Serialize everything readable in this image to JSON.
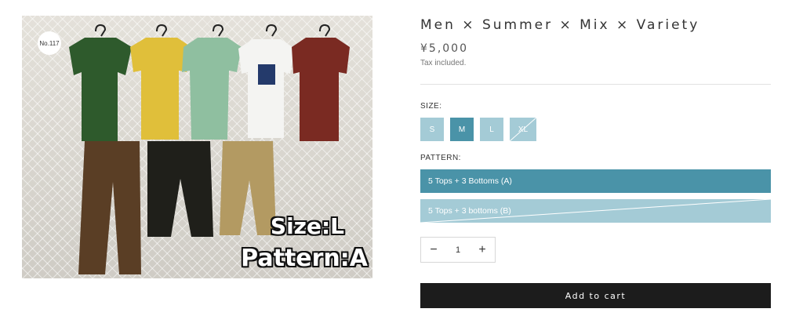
{
  "image": {
    "badge": "No.117",
    "overlay_size": "Size:L",
    "overlay_pattern": "Pattern:A"
  },
  "product": {
    "title": "Men × Summer × Mix × Variety",
    "price": "¥5,000",
    "tax_note": "Tax included."
  },
  "options": {
    "size_label": "SIZE:",
    "sizes": [
      {
        "label": "S",
        "state": "available"
      },
      {
        "label": "M",
        "state": "selected"
      },
      {
        "label": "L",
        "state": "available"
      },
      {
        "label": "XL",
        "state": "sold-out"
      }
    ],
    "pattern_label": "PATTERN:",
    "patterns": [
      {
        "label": "5 Tops + 3 Bottoms (A)",
        "state": "selected"
      },
      {
        "label": "5 Tops + 3 bottoms (B)",
        "state": "sold-out"
      }
    ]
  },
  "quantity": {
    "minus": "−",
    "value": "1",
    "plus": "+"
  },
  "cart": {
    "add_label": "Add to cart"
  },
  "colors": {
    "selected": "#4a93a8",
    "available": "#a4cbd6",
    "button_dark": "#1c1c1c"
  }
}
